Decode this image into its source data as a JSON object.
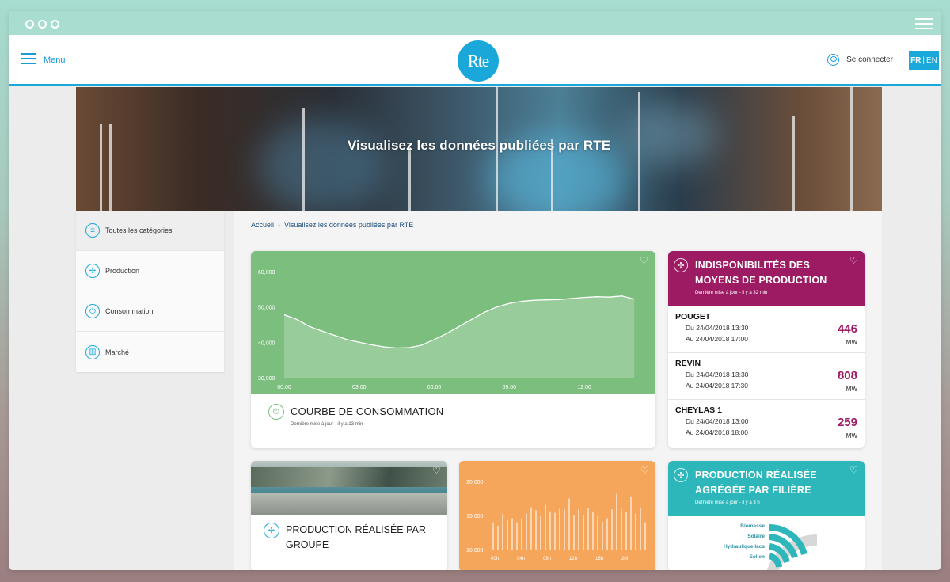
{
  "header": {
    "menu_label": "Menu",
    "logo_text": "Rte",
    "login_label": "Se connecter",
    "lang_fr": "FR",
    "lang_sep": "|",
    "lang_en": "EN"
  },
  "hero": {
    "title": "Visualisez les données publiées par RTE"
  },
  "sidebar": {
    "items": [
      {
        "label": "Toutes les catégories",
        "icon": "list-icon"
      },
      {
        "label": "Production",
        "icon": "production-icon"
      },
      {
        "label": "Consommation",
        "icon": "plug-icon"
      },
      {
        "label": "Marché",
        "icon": "market-icon"
      }
    ]
  },
  "breadcrumb": {
    "home": "Accueil",
    "current": "Visualisez les données publiées par RTE"
  },
  "consumption_card": {
    "title": "COURBE DE CONSOMMATION",
    "updated": "Dernière mise à jour - il y a 13 min",
    "chart_data": {
      "type": "area",
      "y_ticks": [
        "60,000",
        "50,000",
        "40,000",
        "30,000"
      ],
      "x_ticks": [
        "00:00",
        "03:00",
        "06:00",
        "09:00",
        "12:00"
      ],
      "ylim": [
        30000,
        60000
      ],
      "xlim": [
        0,
        14.5
      ],
      "x": [
        0,
        0.5,
        1,
        1.5,
        2,
        2.5,
        3,
        3.5,
        4,
        4.5,
        5,
        5.5,
        6,
        6.5,
        7,
        7.5,
        8,
        8.5,
        9,
        9.5,
        10,
        10.5,
        11,
        11.5,
        12,
        12.5,
        13,
        13.5,
        14
      ],
      "values": [
        47800,
        46500,
        44500,
        43200,
        42000,
        40800,
        40000,
        39300,
        38700,
        38400,
        38500,
        39200,
        40800,
        42500,
        44500,
        46500,
        48500,
        50000,
        51000,
        51600,
        51900,
        52000,
        52100,
        52400,
        52700,
        52900,
        52800,
        53100,
        52200
      ]
    }
  },
  "unavailability_card": {
    "title_line1": "INDISPONIBILITÉS DES",
    "title_line2": "MOYENS DE PRODUCTION",
    "updated": "Dernière mise à jour - il y a 32 min",
    "rows": [
      {
        "name": "POUGET",
        "from": "Du 24/04/2018 13:30",
        "to": "Au 24/04/2018 17:00",
        "value": "446",
        "unit": "MW"
      },
      {
        "name": "REVIN",
        "from": "Du 24/04/2018 13:30",
        "to": "Au 24/04/2018 17:30",
        "value": "808",
        "unit": "MW"
      },
      {
        "name": "CHEYLAS 1",
        "from": "Du 24/04/2018 13:00",
        "to": "Au 24/04/2018 18:00",
        "value": "259",
        "unit": "MW"
      }
    ]
  },
  "group_card": {
    "title": "PRODUCTION RÉALISÉE PAR GROUPE"
  },
  "orange_card": {
    "chart_data": {
      "type": "bar",
      "y_ticks": [
        "20,000",
        "15,000",
        "10,000"
      ],
      "ylim": [
        10000,
        20000
      ],
      "x_ticks": [
        "00h",
        "04h",
        "08h",
        "12h",
        "16h",
        "20h"
      ],
      "values": [
        14000,
        13500,
        15200,
        14300,
        14600,
        14000,
        14600,
        15300,
        16200,
        15800,
        14900,
        16600,
        15600,
        15400,
        16000,
        15900,
        17500,
        15100,
        15900,
        15100,
        16100,
        15600,
        14900,
        14100,
        14600,
        15900,
        18200,
        16000,
        15600,
        17700,
        15300,
        16200,
        14000
      ]
    }
  },
  "filiere_card": {
    "title_line1": "PRODUCTION RÉALISÉE",
    "title_line2": "AGRÉGÉE PAR FILIÈRE",
    "updated": "Dernière mise à jour - il y a 3 h",
    "legend": [
      "Biomasse",
      "Solaire",
      "Hydraulique lacs",
      "Eolien"
    ]
  },
  "colors": {
    "rte_blue": "#1aa8db",
    "green": "#7cbe7e",
    "purple": "#9c1b62",
    "orange": "#f5a65b",
    "teal": "#2db7ba"
  }
}
